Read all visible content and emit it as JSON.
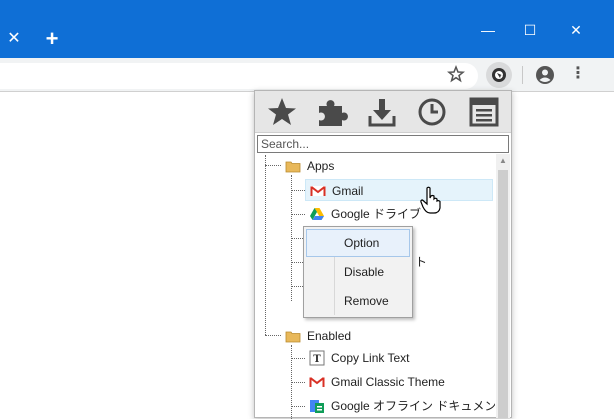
{
  "window": {
    "tab_close": "✕",
    "new_tab": "+",
    "minimize": "—",
    "maximize": "☐",
    "close": "✕"
  },
  "toolbar": {
    "bookmark_icon": "star-outline-icon",
    "extension_icon": "extension-manager-icon",
    "profile_icon": "profile-icon",
    "menu_icon": "⋮"
  },
  "popup": {
    "toolbar_buttons": [
      "star-icon",
      "puzzle-icon",
      "download-icon",
      "clock-icon",
      "list-icon"
    ],
    "search_placeholder": "Search...",
    "groups": [
      {
        "label": "Apps",
        "items": [
          {
            "label": "Gmail",
            "icon": "gmail-icon"
          },
          {
            "label": "Google ドライブ",
            "icon": "google-drive-icon"
          },
          {
            "label": "ト",
            "icon": ""
          }
        ]
      },
      {
        "label": "Enabled",
        "items": [
          {
            "label": "Copy Link Text",
            "icon": "text-icon"
          },
          {
            "label": "Gmail Classic Theme",
            "icon": "gmail-icon"
          },
          {
            "label": "Google オフライン ドキュメン",
            "icon": "google-docs-offline-icon"
          }
        ]
      }
    ]
  },
  "context_menu": {
    "items": [
      "Option",
      "Disable",
      "Remove"
    ],
    "active": "Option"
  },
  "colors": {
    "titlebar": "#0f6fd6",
    "toolbar": "#f1f3f4",
    "highlight": "#e5f3fb",
    "folder": "#e8b85a",
    "gmail_red": "#d93025"
  }
}
